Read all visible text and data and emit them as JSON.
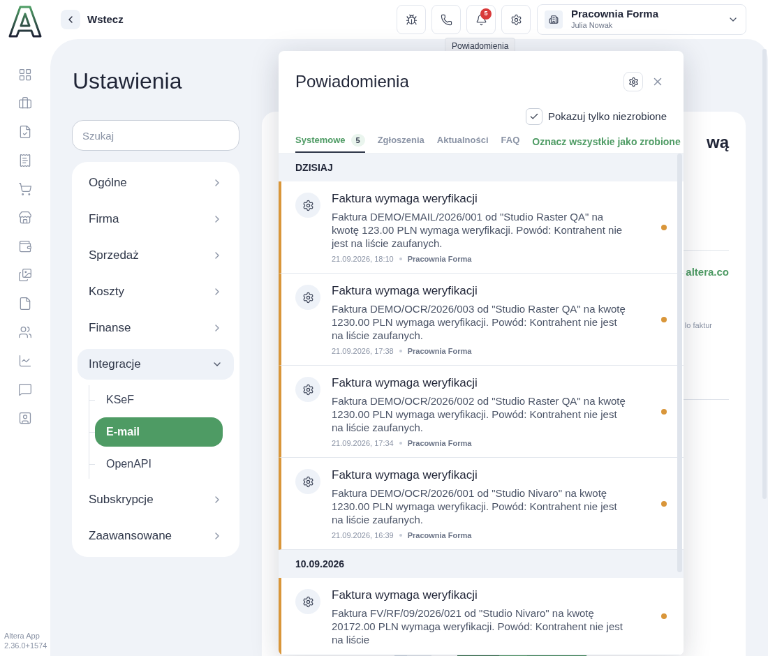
{
  "header": {
    "back_label": "Wstecz",
    "notification_count": "5",
    "tooltip": "Powiadomienia",
    "account": {
      "name": "Pracownia Forma",
      "user": "Julia Nowak"
    }
  },
  "app_version": {
    "name": "Altera App",
    "version": "2.36.0+1574"
  },
  "settings": {
    "title": "Ustawienia",
    "search": {
      "placeholder": "Szukaj"
    },
    "menu": [
      {
        "label": "Ogólne",
        "expanded": false
      },
      {
        "label": "Firma",
        "expanded": false
      },
      {
        "label": "Sprzedaż",
        "expanded": false
      },
      {
        "label": "Koszty",
        "expanded": false
      },
      {
        "label": "Finanse",
        "expanded": false
      },
      {
        "label": "Integracje",
        "expanded": true,
        "children": [
          {
            "label": "KSeF",
            "selected": false
          },
          {
            "label": "E-mail",
            "selected": true
          },
          {
            "label": "OpenAPI",
            "selected": false
          }
        ]
      },
      {
        "label": "Subskrypcje",
        "expanded": false
      },
      {
        "label": "Zaawansowane",
        "expanded": false
      }
    ]
  },
  "background_card": {
    "heading_fragment": "wą",
    "link_fragment": "altera.co",
    "text_fragment": "lo faktur"
  },
  "notifications": {
    "title": "Powiadomienia",
    "filter": {
      "label": "Pokazuj tylko niezrobione",
      "checked": true
    },
    "tabs": [
      {
        "label": "Systemowe",
        "count": "5",
        "selected": true
      },
      {
        "label": "Zgłoszenia",
        "selected": false
      },
      {
        "label": "Aktualności",
        "selected": false
      },
      {
        "label": "FAQ",
        "selected": false
      }
    ],
    "mark_all": "Oznacz wszystkie jako zrobione",
    "groups": [
      {
        "label": "DZISIAJ",
        "items": [
          {
            "title": "Faktura wymaga weryfikacji",
            "body": "Faktura DEMO/EMAIL/2026/001 od \"Studio Raster QA\" na kwotę 123.00 PLN wymaga weryfikacji. Powód: Kontrahent nie jest na liście zaufanych.",
            "time": "21.09.2026, 18:10",
            "company": "Pracownia Forma",
            "unread": true
          },
          {
            "title": "Faktura wymaga weryfikacji",
            "body": "Faktura DEMO/OCR/2026/003 od \"Studio Raster QA\" na kwotę 1230.00 PLN wymaga weryfikacji. Powód: Kontrahent nie jest na liście zaufanych.",
            "time": "21.09.2026, 17:38",
            "company": "Pracownia Forma",
            "unread": true
          },
          {
            "title": "Faktura wymaga weryfikacji",
            "body": "Faktura DEMO/OCR/2026/002 od \"Studio Raster QA\" na kwotę 1230.00 PLN wymaga weryfikacji. Powód: Kontrahent nie jest na liście zaufanych.",
            "time": "21.09.2026, 17:34",
            "company": "Pracownia Forma",
            "unread": true
          },
          {
            "title": "Faktura wymaga weryfikacji",
            "body": "Faktura DEMO/OCR/2026/001 od \"Studio Nivaro\" na kwotę 1230.00 PLN wymaga weryfikacji. Powód: Kontrahent nie jest na liście zaufanych.",
            "time": "21.09.2026, 16:39",
            "company": "Pracownia Forma",
            "unread": true
          }
        ]
      },
      {
        "label": "10.09.2026",
        "items": [
          {
            "title": "Faktura wymaga weryfikacji",
            "body": "Faktura FV/RF/09/2026/021 od \"Studio Nivaro\" na kwotę 20172.00 PLN wymaga weryfikacji. Powód: Kontrahent nie jest na liście",
            "unread": true
          }
        ]
      }
    ]
  }
}
